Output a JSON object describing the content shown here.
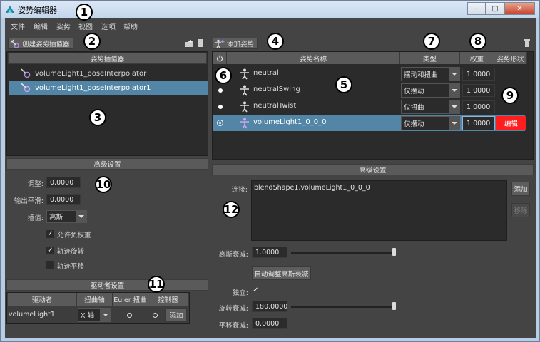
{
  "window": {
    "title": "姿势编辑器",
    "min": "–",
    "max": "▢",
    "close": "✕"
  },
  "menu": [
    "文件",
    "编辑",
    "姿势",
    "视图",
    "选项",
    "帮助"
  ],
  "callouts": [
    "1",
    "2",
    "3",
    "4",
    "5",
    "6",
    "7",
    "8",
    "9",
    "10",
    "11",
    "12"
  ],
  "left_toolbar": {
    "create_label": "创建姿势插值器"
  },
  "interpolators": {
    "header": "姿势插值器",
    "items": [
      "volumeLight1_poseInterpolator",
      "volumeLight1_poseInterpolator1"
    ]
  },
  "left_advanced": {
    "header": "高级设置",
    "adjust_label": "调整:",
    "adjust_value": "0.0000",
    "smooth_label": "输出平滑:",
    "smooth_value": "0.0000",
    "interp_label": "插值:",
    "interp_value": "高斯",
    "allow_neg_label": "允许负权重",
    "allow_neg": true,
    "track_rot_label": "轨迹旋转",
    "track_rot": true,
    "track_trans_label": "轨迹平移",
    "track_trans": false
  },
  "driver": {
    "header": "驱动者设置",
    "columns": [
      "驱动者",
      "扭曲轴",
      "Euler 扭曲",
      "控制器"
    ],
    "row": {
      "driver": "volumeLight1",
      "axis": "X 轴",
      "add": "添加"
    }
  },
  "right_toolbar": {
    "add_pose_label": "添加姿势"
  },
  "poses": {
    "columns": [
      "姿势名称",
      "类型",
      "权重",
      "姿势形状"
    ],
    "rows": [
      {
        "name": "neutral",
        "type": "摆动和扭曲",
        "weight": "1.0000",
        "marker": ""
      },
      {
        "name": "neutralSwing",
        "type": "仅摆动",
        "weight": "1.0000",
        "marker": "dot"
      },
      {
        "name": "neutralTwist",
        "type": "仅扭曲",
        "weight": "1.0000",
        "marker": "dot"
      },
      {
        "name": "volumeLight1_0_0_0",
        "type": "仅摆动",
        "weight": "1.0000",
        "marker": "radio",
        "shape": "编辑"
      }
    ]
  },
  "right_advanced": {
    "header": "高级设置",
    "connect_label": "连接:",
    "connect_value": "blendShape1.volumeLight1_0_0_0",
    "add_label": "添加",
    "remove_label": "移除",
    "gauss_label": "高斯衰减:",
    "gauss_value": "1.0000",
    "auto_gauss_label": "自动调整高斯衰减",
    "independent_label": "独立:",
    "independent": true,
    "rot_falloff_label": "旋转衰减:",
    "rot_falloff_value": "180.0000",
    "trans_falloff_label": "平移衰减:",
    "trans_falloff_value": "0.0000"
  }
}
